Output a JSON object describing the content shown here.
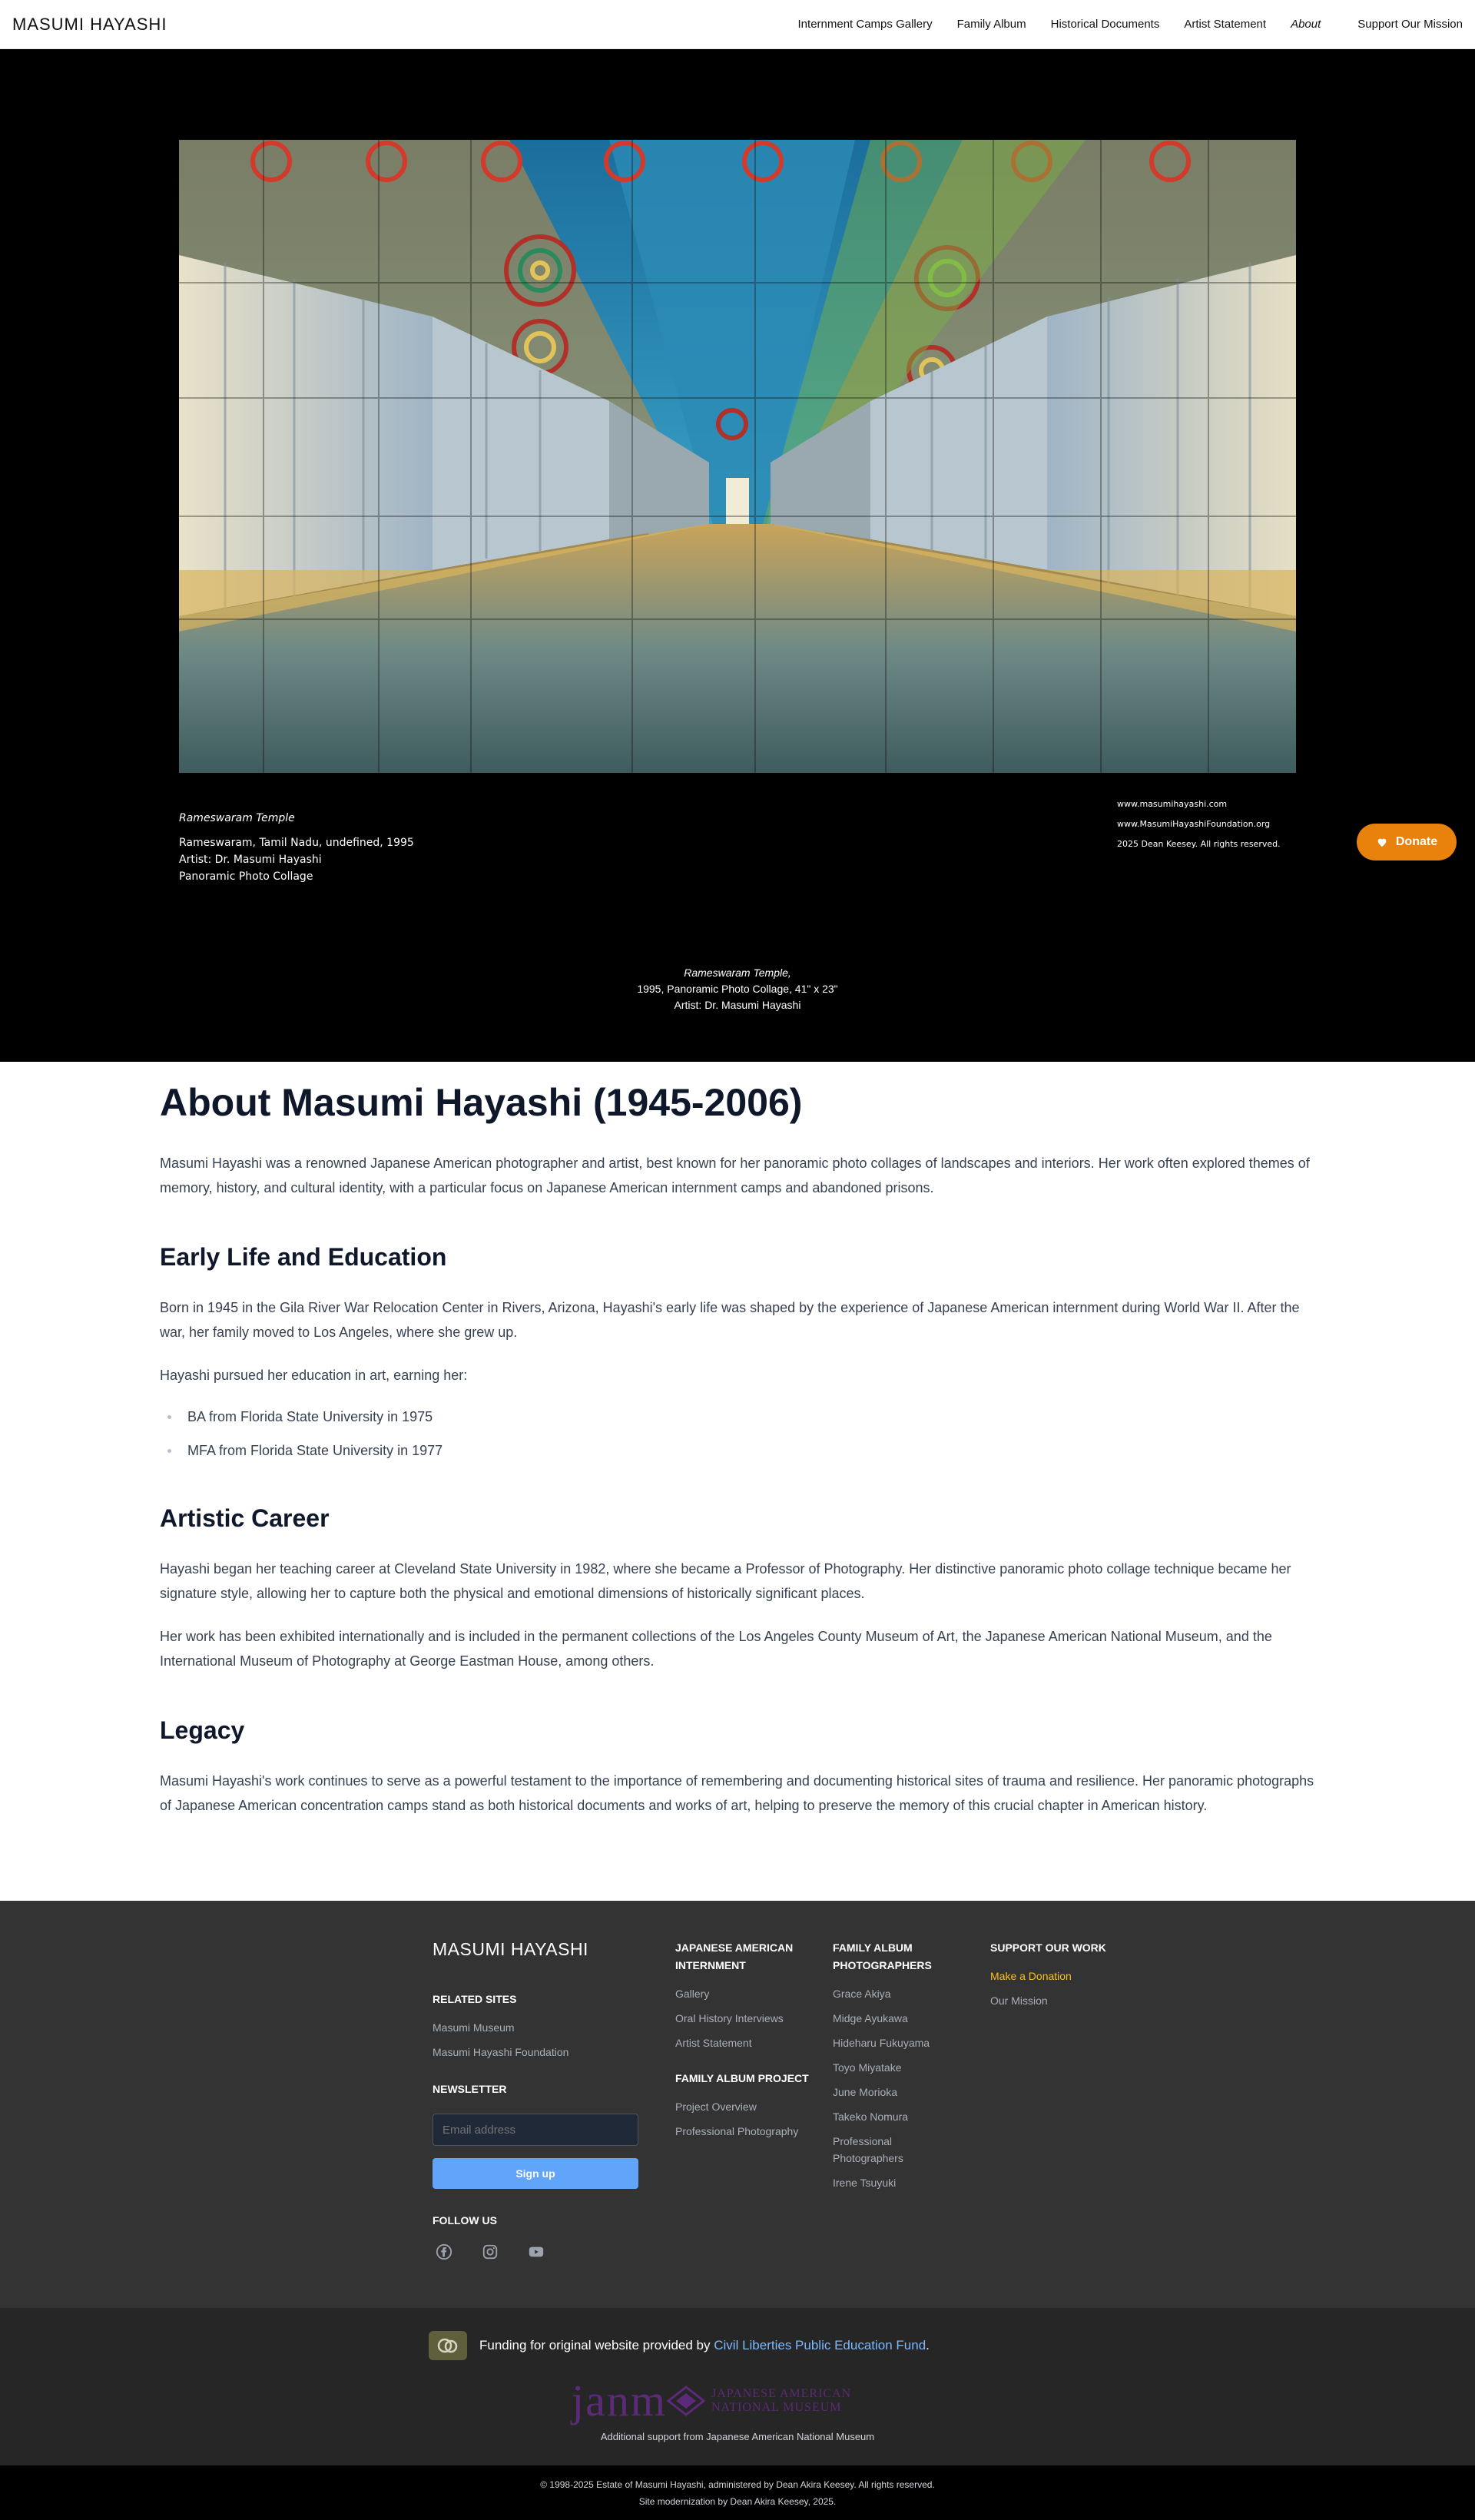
{
  "header": {
    "brand": "MASUMI HAYASHI",
    "nav": [
      {
        "label": "Internment Camps Gallery"
      },
      {
        "label": "Family Album"
      },
      {
        "label": "Historical Documents"
      },
      {
        "label": "Artist Statement"
      },
      {
        "label": "About"
      }
    ],
    "support_label": "Support Our Mission"
  },
  "hero": {
    "artwork": {
      "title": "Rameswaram Temple",
      "location_line": "Rameswaram, Tamil Nadu, undefined, 1995",
      "artist_line": "Artist: Dr. Masumi Hayashi",
      "medium_line": "Panoramic Photo Collage"
    },
    "credits": [
      "www.masumihayashi.com",
      "www.MasumiHayashiFoundation.org",
      "2025 Dean Keesey. All rights reserved."
    ],
    "caption": {
      "title": "Rameswaram Temple,",
      "details": "1995, Panoramic Photo Collage, 41\" x 23\"",
      "artist": "Artist: Dr. Masumi Hayashi"
    },
    "donate_label": "Donate"
  },
  "about": {
    "title": "About Masumi Hayashi (1945-2006)",
    "intro": "Masumi Hayashi was a renowned Japanese American photographer and artist, best known for her panoramic photo collages of landscapes and interiors. Her work often explored themes of memory, history, and cultural identity, with a particular focus on Japanese American internment camps and abandoned prisons.",
    "early": {
      "heading": "Early Life and Education",
      "p1": "Born in 1945 in the Gila River War Relocation Center in Rivers, Arizona, Hayashi's early life was shaped by the experience of Japanese American internment during World War II. After the war, her family moved to Los Angeles, where she grew up.",
      "p2": "Hayashi pursued her education in art, earning her:",
      "list": [
        "BA from Florida State University in 1975",
        "MFA from Florida State University in 1977"
      ]
    },
    "career": {
      "heading": "Artistic Career",
      "p1": "Hayashi began her teaching career at Cleveland State University in 1982, where she became a Professor of Photography. Her distinctive panoramic photo collage technique became her signature style, allowing her to capture both the physical and emotional dimensions of historically significant places.",
      "p2": "Her work has been exhibited internationally and is included in the permanent collections of the Los Angeles County Museum of Art, the Japanese American National Museum, and the International Museum of Photography at George Eastman House, among others."
    },
    "legacy": {
      "heading": "Legacy",
      "p1": "Masumi Hayashi's work continues to serve as a powerful testament to the importance of remembering and documenting historical sites of trauma and resilience. Her panoramic photographs of Japanese American concentration camps stand as both historical documents and works of art, helping to preserve the memory of this crucial chapter in American history."
    }
  },
  "footer": {
    "brand": "MASUMI HAYASHI",
    "related_heading": "RELATED SITES",
    "related": [
      "Masumi Museum",
      "Masumi Hayashi Foundation"
    ],
    "newsletter_heading": "NEWSLETTER",
    "email_placeholder": "Email address",
    "signup_label": "Sign up",
    "follow_heading": "FOLLOW US",
    "social_icons": [
      "facebook-icon",
      "instagram-icon",
      "youtube-icon"
    ],
    "col2_heading": "JAPANESE AMERICAN INTERNMENT",
    "col2_links": [
      "Gallery",
      "Oral History Interviews",
      "Artist Statement"
    ],
    "col2b_heading": "FAMILY ALBUM PROJECT",
    "col2b_links": [
      "Project Overview",
      "Professional Photography"
    ],
    "col3_heading": "FAMILY ALBUM PHOTOGRAPHERS",
    "col3_links": [
      "Grace Akiya",
      "Midge Ayukawa",
      "Hideharu Fukuyama",
      "Toyo Miyatake",
      "June Morioka",
      "Takeko Nomura",
      "Professional Photographers",
      "Irene Tsuyuki"
    ],
    "col4_heading": "SUPPORT OUR WORK",
    "col4_links": [
      "Make a Donation",
      "Our Mission"
    ],
    "funding_prefix": "Funding for original website provided by ",
    "funding_link": "Civil Liberties Public Education Fund",
    "funding_suffix": ".",
    "janm_word": "janm",
    "janm_line1": "JAPANESE AMERICAN",
    "janm_line2": "NATIONAL MUSEUM",
    "additional_support": "Additional support from Japanese American National Museum",
    "copyright": "© 1998-2025 Estate of Masumi Hayashi, administered by Dean Akira Keesey. All rights reserved.",
    "modernization": "Site modernization by Dean Akira Keesey, 2025."
  },
  "colors": {
    "donate": "#e8820c",
    "accent_link": "#fbbf24",
    "signup": "#60a5fa",
    "janm_purple": "#5c2a78"
  }
}
